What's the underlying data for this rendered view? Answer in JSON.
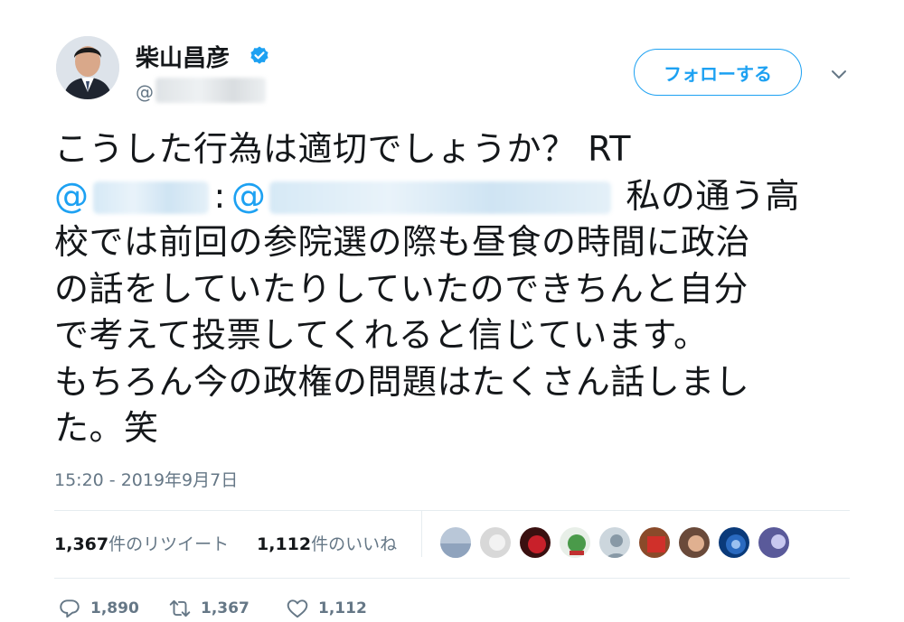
{
  "author": {
    "name": "柴山昌彦",
    "handle_prefix": "@",
    "verified": true
  },
  "follow_button_label": "フォローする",
  "tweet": {
    "lines": [
      {
        "before": "こうした行為は適切でしょうか？ RT",
        "mention": false
      },
      {
        "at1": "@",
        "colon": ":",
        "at2": "@",
        "after": "私の通う高",
        "mention": true
      },
      {
        "text": "校では前回の参院選の際も昼食の時間に政治"
      },
      {
        "text": "の話をしていたりしていたのできちんと自分"
      },
      {
        "text": "で考えて投票してくれると信じています。"
      },
      {
        "text": "もちろん今の政権の問題はたくさん話しまし"
      },
      {
        "text": "た。笑"
      }
    ]
  },
  "timestamp": "15:20 - 2019年9月7日",
  "stats": {
    "retweets_count": "1,367",
    "retweets_label": "件のリツイート",
    "likes_count": "1,112",
    "likes_label": "件のいいね"
  },
  "actions": {
    "reply_count": "1,890",
    "retweet_count": "1,367",
    "like_count": "1,112"
  },
  "colors": {
    "accent": "#1da1f2",
    "secondary_text": "#657786",
    "primary_text": "#14171a"
  },
  "icons": [
    "verified-badge-icon",
    "chevron-down-icon",
    "reply-icon",
    "retweet-icon",
    "like-icon"
  ]
}
